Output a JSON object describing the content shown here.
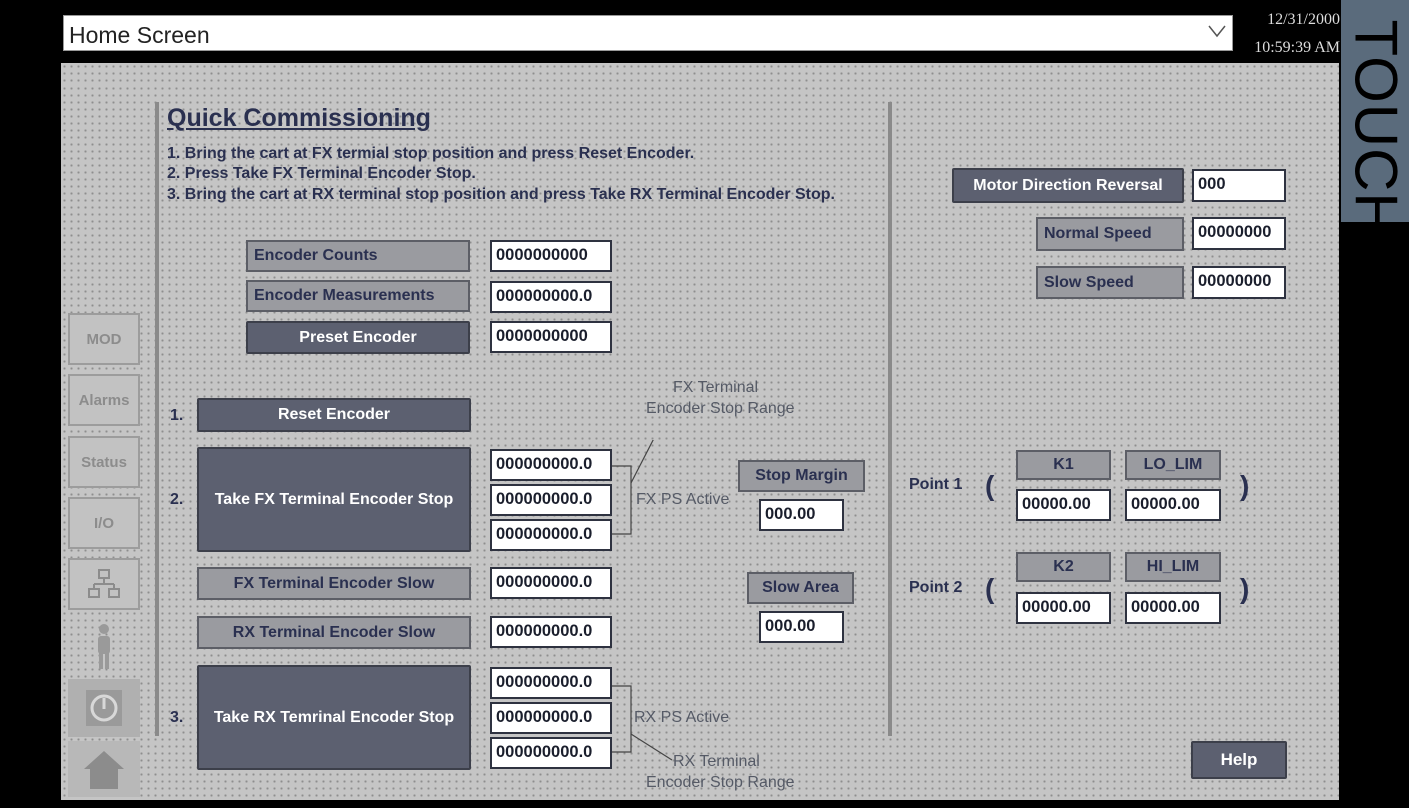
{
  "header": {
    "screen_name": "Home Screen",
    "date": "12/31/2000",
    "time": "10:59:39 AM",
    "brand": "TOUCH"
  },
  "sidebar": {
    "mod": "MOD",
    "alarms": "Alarms",
    "status": "Status",
    "io": "I/O"
  },
  "section": {
    "title": "Quick Commissioning",
    "instructions": [
      "1. Bring the cart at FX termial stop position and press Reset Encoder.",
      "2. Press Take FX Terminal Encoder Stop.",
      "3. Bring the cart at RX terminal stop position and press Take RX Terminal Encoder Stop."
    ]
  },
  "encoder": {
    "counts_label": "Encoder Counts",
    "counts_value": "0000000000",
    "measurements_label": "Encoder Measurements",
    "measurements_value": "000000000.0",
    "preset_label": "Preset Encoder",
    "preset_value": "0000000000"
  },
  "steps": {
    "n1": "1.",
    "n2": "2.",
    "n3": "3.",
    "reset_label": "Reset Encoder",
    "take_fx_label": "Take FX Terminal Encoder Stop",
    "take_rx_label": "Take RX Temrinal Encoder Stop",
    "fx_values": [
      "000000000.0",
      "000000000.0",
      "000000000.0"
    ],
    "rx_values": [
      "000000000.0",
      "000000000.0",
      "000000000.0"
    ],
    "fx_slow_label": "FX Terminal Encoder Slow",
    "fx_slow_value": "000000000.0",
    "rx_slow_label": "RX Terminal Encoder Slow",
    "rx_slow_value": "000000000.0"
  },
  "annotations": {
    "fx_range_line1": "FX Terminal",
    "fx_range_line2": "Encoder Stop Range",
    "fx_ps_active": "FX PS Active",
    "rx_ps_active": "RX PS Active",
    "rx_range_line1": "RX Terminal",
    "rx_range_line2": "Encoder Stop Range"
  },
  "margins": {
    "stop_margin_label": "Stop Margin",
    "stop_margin_value": "000.00",
    "slow_area_label": "Slow Area",
    "slow_area_value": "000.00"
  },
  "motor": {
    "reversal_label": "Motor Direction Reversal",
    "reversal_value": "000",
    "normal_label": "Normal Speed",
    "normal_value": "00000000",
    "slow_label": "Slow Speed",
    "slow_value": "00000000"
  },
  "points": {
    "p1_label": "Point 1",
    "p2_label": "Point 2",
    "open": "(",
    "close": ")",
    "k1_label": "K1",
    "k2_label": "K2",
    "lo_lim_label": "LO_LIM",
    "hi_lim_label": "HI_LIM",
    "k1_value": "00000.00",
    "lo_lim_value": "00000.00",
    "k2_value": "00000.00",
    "hi_lim_value": "00000.00"
  },
  "help_label": "Help"
}
